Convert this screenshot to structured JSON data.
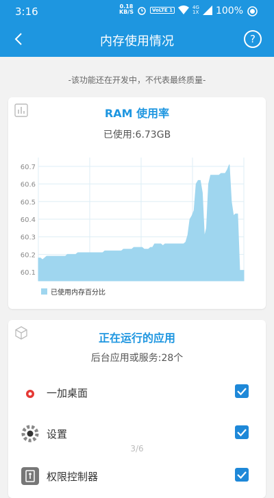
{
  "status_bar": {
    "time": "3:16",
    "net_speed_value": "0.18",
    "net_speed_unit": "KB/S",
    "volte": "VoLTE 1",
    "network": "4G",
    "sim": "1X",
    "battery": "100%"
  },
  "header": {
    "title": "内存使用情况"
  },
  "notice": "-该功能还在开发中，不代表最终质量-",
  "ram_card": {
    "title": "RAM 使用率",
    "used": "已使用:6.73GB",
    "icon": "bar-chart-icon"
  },
  "chart_data": {
    "type": "area",
    "series": [
      {
        "name": "已使用内存百分比",
        "color": "#9fd6ef",
        "x": [
          0,
          1,
          2,
          3,
          4,
          5,
          6,
          7,
          8,
          9,
          10,
          11,
          12,
          13,
          14,
          15,
          16,
          17,
          18,
          19,
          20,
          21,
          22,
          23,
          24,
          25,
          26,
          27,
          28,
          29,
          30,
          31,
          32,
          33,
          34,
          35,
          36,
          37,
          38,
          39,
          40,
          41,
          42,
          43,
          44,
          45,
          46,
          47,
          48,
          49,
          50,
          51,
          52,
          53,
          54,
          55,
          56,
          57,
          58,
          59,
          60,
          61,
          62,
          63,
          64,
          65,
          66,
          67,
          68,
          69,
          70,
          71,
          72,
          73,
          74,
          75,
          76,
          77,
          78,
          79,
          80,
          81,
          82,
          83,
          84,
          85,
          86,
          87,
          88,
          89,
          90,
          91,
          92,
          93,
          94,
          95,
          96,
          97,
          98,
          99
        ],
        "values": [
          60.18,
          60.18,
          60.17,
          60.18,
          60.19,
          60.19,
          60.19,
          60.19,
          60.19,
          60.19,
          60.19,
          60.19,
          60.19,
          60.19,
          60.2,
          60.2,
          60.2,
          60.2,
          60.2,
          60.21,
          60.21,
          60.21,
          60.21,
          60.21,
          60.21,
          60.21,
          60.21,
          60.21,
          60.21,
          60.21,
          60.21,
          60.21,
          60.22,
          60.22,
          60.22,
          60.22,
          60.22,
          60.22,
          60.22,
          60.22,
          60.22,
          60.23,
          60.23,
          60.23,
          60.23,
          60.23,
          60.24,
          60.24,
          60.24,
          60.24,
          60.24,
          60.23,
          60.23,
          60.23,
          60.24,
          60.24,
          60.26,
          60.26,
          60.26,
          60.26,
          60.25,
          60.26,
          60.26,
          60.26,
          60.26,
          60.26,
          60.26,
          60.26,
          60.26,
          60.26,
          60.26,
          60.27,
          60.31,
          60.4,
          60.42,
          60.45,
          60.6,
          60.62,
          60.62,
          60.55,
          60.3,
          60.35,
          60.6,
          60.65,
          60.65,
          60.65,
          60.65,
          60.65,
          60.66,
          60.66,
          60.66,
          60.68,
          60.71,
          60.5,
          60.42,
          60.43,
          60.43,
          60.11,
          60.11,
          60.11
        ]
      }
    ],
    "ylim": [
      60.05,
      60.75
    ],
    "yticks": [
      "60.1",
      "60.2",
      "60.3",
      "60.4",
      "60.5",
      "60.6",
      "60.7"
    ],
    "grid": true,
    "legend": "bottom-left"
  },
  "running_card": {
    "title": "正在运行的应用",
    "subtitle": "后台应用或服务:28个",
    "icon": "cube-icon"
  },
  "apps": [
    {
      "name": "一加桌面",
      "icon": "oneplus-launcher-icon",
      "checked": true
    },
    {
      "name": "设置",
      "icon": "settings-gear-icon",
      "checked": true
    },
    {
      "name": "权限控制器",
      "icon": "permission-controller-icon",
      "checked": true
    }
  ],
  "pager": "3/6",
  "colors": {
    "accent": "#1e96e0",
    "chart_fill": "#9fd6ef",
    "checkbox": "#1e88d8"
  }
}
